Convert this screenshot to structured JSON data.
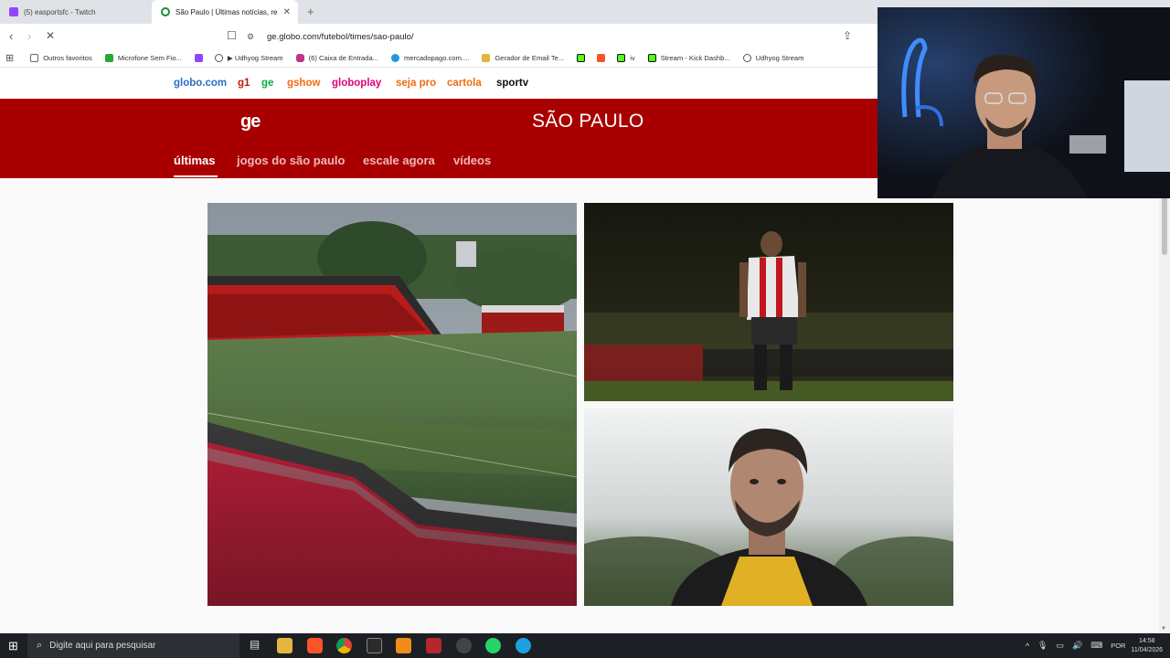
{
  "browser": {
    "tabs": [
      {
        "title": "(5) easportsfc - Twitch",
        "active": false
      },
      {
        "title": "São Paulo | Últimas notícias, resu",
        "active": true
      }
    ],
    "url": "ge.globo.com/futebol/times/sao-paulo/",
    "bookmarks": [
      {
        "label": "Outros favoritos",
        "icon": "folder-icon"
      },
      {
        "label": "Microfone Sem Fio...",
        "icon": "bookmark-icon"
      },
      {
        "label": "",
        "icon": "twitch-icon"
      },
      {
        "label": "▶ Udhyog Stream",
        "icon": "globe-icon"
      },
      {
        "label": "(6) Caixa de Entrada...",
        "icon": "instagram-icon"
      },
      {
        "label": "mercadopago.com....",
        "icon": "mercadopago-icon"
      },
      {
        "label": "Gerador de Email Te...",
        "icon": "pen-icon"
      },
      {
        "label": "",
        "icon": "kick-icon"
      },
      {
        "label": "",
        "icon": "brave-icon"
      },
      {
        "label": "iv",
        "icon": "kick-icon"
      },
      {
        "label": "Stream - Kick Dashb...",
        "icon": "kick-icon"
      },
      {
        "label": "Udhyog Stream",
        "icon": "globe-icon"
      }
    ]
  },
  "globo_nav": [
    {
      "label": "globo.com",
      "color": "#2a6fc4"
    },
    {
      "label": "g1",
      "color": "#c4170c"
    },
    {
      "label": "ge",
      "color": "#06aa48"
    },
    {
      "label": "gshow",
      "color": "#f06a0f"
    },
    {
      "label": "globoplay",
      "color": "#e0007a"
    },
    {
      "label": "seja pro",
      "color": "#f06a0f"
    },
    {
      "label": "cartola",
      "color": "#ee6d0f"
    },
    {
      "label": "sportv",
      "color": "#111111"
    }
  ],
  "header": {
    "logo": "ge",
    "title": "SÃO PAULO",
    "accent": "#a80000"
  },
  "subnav": [
    {
      "label": "últimas",
      "active": true
    },
    {
      "label": "jogos do são paulo",
      "active": false
    },
    {
      "label": "escale agora",
      "active": false
    },
    {
      "label": "vídeos",
      "active": false
    }
  ],
  "cards": [
    {
      "subject": "stadium-photo"
    },
    {
      "subject": "player-photo-sao-paulo-kit"
    },
    {
      "subject": "player-portrait-photo"
    }
  ],
  "taskbar": {
    "search_placeholder": "Digite aqui para pesquisar",
    "language": "POR",
    "time": "14:58",
    "date": "11/04/2026",
    "apps": [
      "task-view",
      "file-explorer",
      "brave",
      "chrome",
      "app",
      "app",
      "app",
      "app",
      "whatsapp",
      "edge"
    ]
  }
}
